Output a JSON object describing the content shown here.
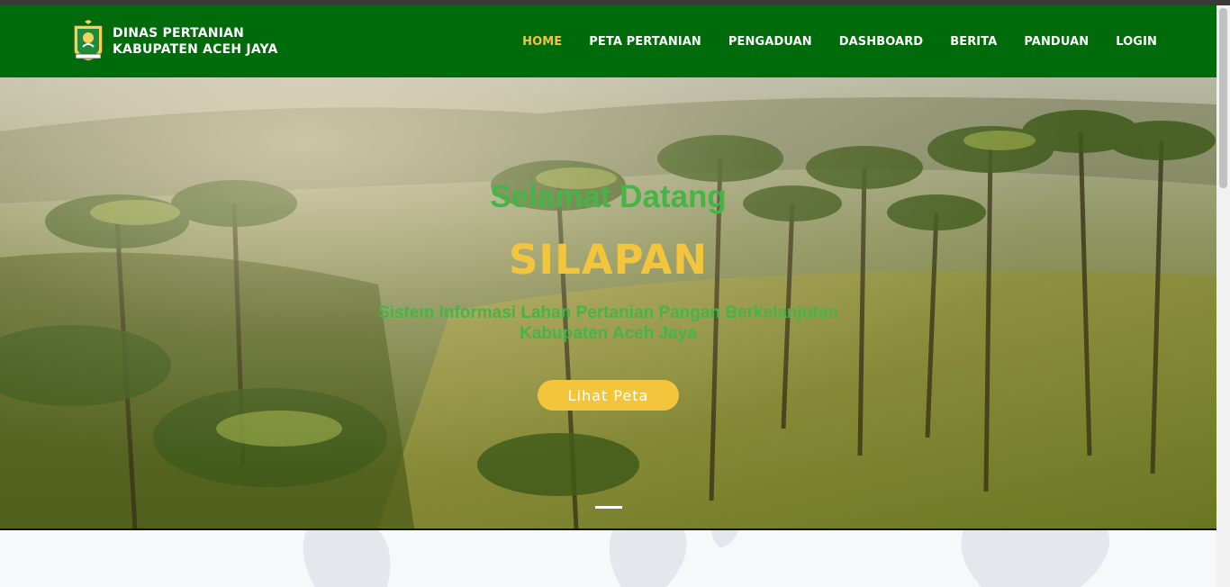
{
  "brand": {
    "line1": "DINAS PERTANIAN",
    "line2": "KABUPATEN ACEH JAYA",
    "logo_icon": "aceh-jaya-crest-icon"
  },
  "nav": {
    "items": [
      {
        "label": "HOME",
        "active": true
      },
      {
        "label": "PETA PERTANIAN",
        "active": false
      },
      {
        "label": "PENGADUAN",
        "active": false
      },
      {
        "label": "DASHBOARD",
        "active": false
      },
      {
        "label": "BERITA",
        "active": false
      },
      {
        "label": "PANDUAN",
        "active": false
      },
      {
        "label": "LOGIN",
        "active": false
      }
    ]
  },
  "hero": {
    "welcome": "Selamat Datang",
    "app_name": "SILAPAN",
    "subtitle_line1": "Sistem Informasi Lahan Pertanian Pangan Berkelanjutan",
    "subtitle_line2": "Kabupaten Aceh Jaya",
    "cta_label": "Lihat Peta",
    "slide_count": 1,
    "active_slide": 1
  },
  "colors": {
    "navbar": "#006b0b",
    "accent_yellow": "#f2c53d",
    "accent_green": "#45b548",
    "active_nav": "#f6c244"
  }
}
